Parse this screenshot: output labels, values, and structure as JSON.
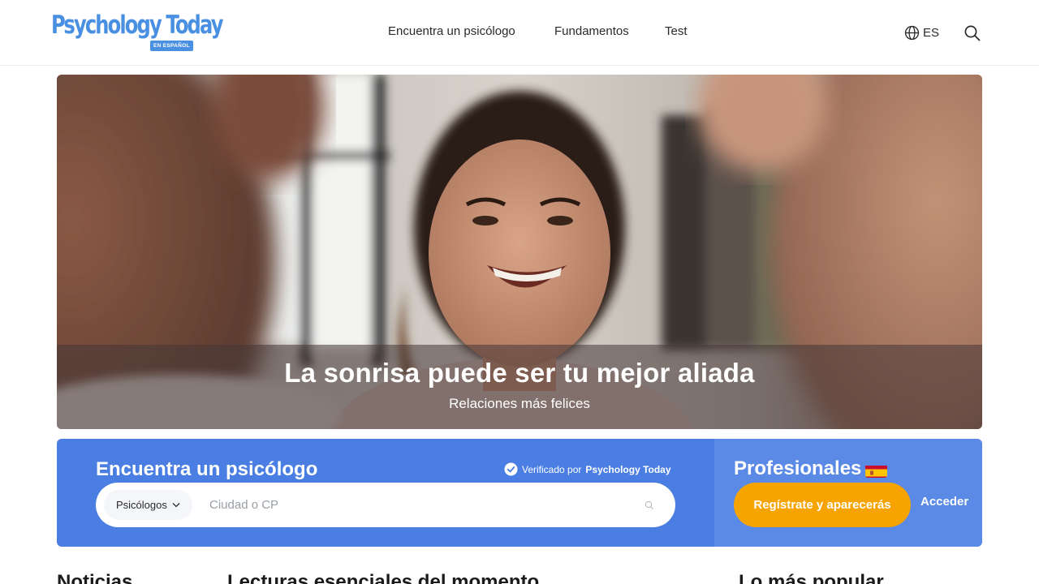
{
  "header": {
    "logo": {
      "text": "Psychology Today",
      "badge": "EN ESPAÑOL"
    },
    "nav": [
      {
        "label": "Encuentra un psicólogo"
      },
      {
        "label": "Fundamentos"
      },
      {
        "label": "Test"
      }
    ],
    "language": "ES",
    "icons": {
      "language": "globe-icon",
      "search": "search-icon"
    }
  },
  "hero": {
    "title": "La sonrisa puede ser tu mejor aliada",
    "subtitle": "Relaciones más felices"
  },
  "finder": {
    "title": "Encuentra un psicólogo",
    "verified_prefix": "Verificado por",
    "verified_brand": "Psychology Today",
    "type_selected": "Psicólogos",
    "location_placeholder": "Ciudad o CP",
    "location_value": ""
  },
  "pros": {
    "title": "Profesionales",
    "register_label": "Regístrate y aparecerás",
    "login_label": "Acceder"
  },
  "sections": {
    "news": "Noticias",
    "essential": "Lecturas esenciales del momento",
    "popular": "Lo más popular"
  },
  "colors": {
    "brand_blue": "#4a90e2",
    "finder_blue": "#4a7ee3",
    "pros_blue": "#5b8ae6",
    "cta_orange": "#f7a400"
  }
}
